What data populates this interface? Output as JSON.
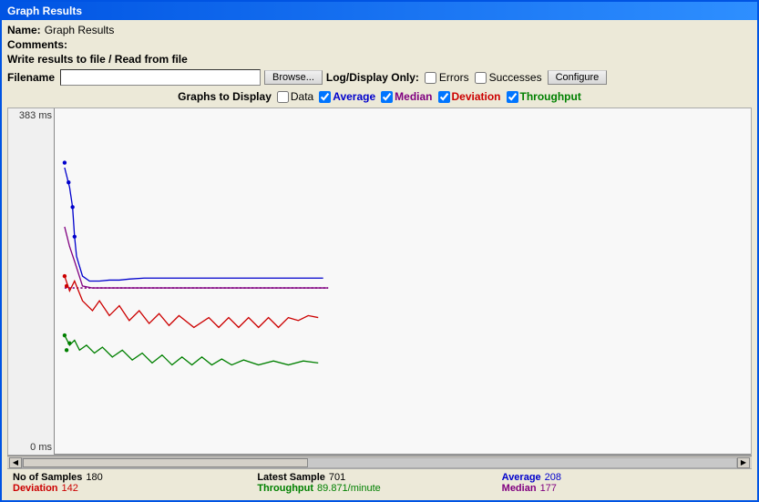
{
  "window": {
    "title": "Graph Results"
  },
  "form": {
    "name_label": "Name:",
    "name_value": "Graph Results",
    "comments_label": "Comments:",
    "write_label": "Write results to file / Read from file",
    "filename_label": "Filename",
    "filename_value": "",
    "browse_btn": "Browse...",
    "log_display_label": "Log/Display Only:",
    "errors_label": "Errors",
    "successes_label": "Successes",
    "configure_btn": "Configure"
  },
  "graphs": {
    "label": "Graphs to Display",
    "items": [
      {
        "id": "data",
        "label": "Data",
        "checked": false,
        "color": "black"
      },
      {
        "id": "average",
        "label": "Average",
        "checked": true,
        "color": "blue"
      },
      {
        "id": "median",
        "label": "Median",
        "checked": true,
        "color": "purple"
      },
      {
        "id": "deviation",
        "label": "Deviation",
        "checked": true,
        "color": "red"
      },
      {
        "id": "throughput",
        "label": "Throughput",
        "checked": true,
        "color": "green"
      }
    ]
  },
  "chart": {
    "y_top": "383 ms",
    "y_bottom": "0 ms"
  },
  "status": {
    "no_of_samples_label": "No of Samples",
    "no_of_samples_value": "180",
    "latest_sample_label": "Latest Sample",
    "latest_sample_value": "701",
    "average_label": "Average",
    "average_value": "208",
    "deviation_label": "Deviation",
    "deviation_value": "142",
    "throughput_label": "Throughput",
    "throughput_value": "89.871/minute",
    "median_label": "Median",
    "median_value": "177"
  }
}
